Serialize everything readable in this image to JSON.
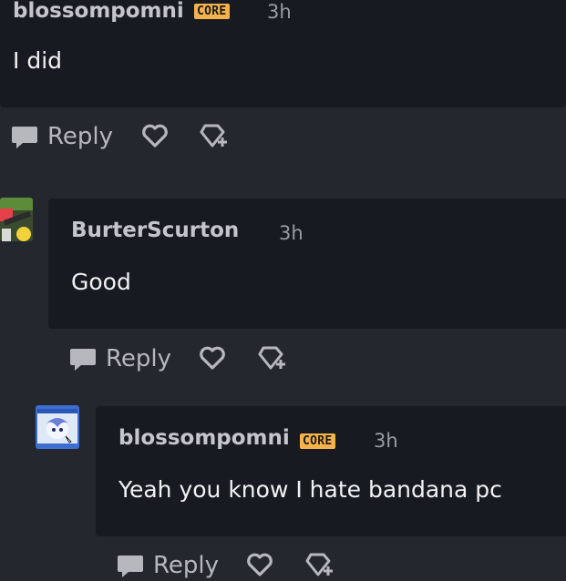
{
  "comments": [
    {
      "username": "blossompomni",
      "badge": "CORE",
      "time": "3h",
      "text": "I did"
    },
    {
      "username": "BurterScurton",
      "badge": "",
      "time": "3h",
      "text": "Good"
    },
    {
      "username": "blossompomni",
      "badge": "CORE",
      "time": "3h",
      "text": "Yeah you know I hate bandana pc"
    }
  ],
  "actions": {
    "reply_label": "Reply"
  },
  "colors": {
    "background": "#24272d",
    "card": "#171a21",
    "badge": "#f6b24a"
  },
  "icons": [
    "chat-bubble-icon",
    "heart-icon",
    "gem-plus-icon"
  ]
}
